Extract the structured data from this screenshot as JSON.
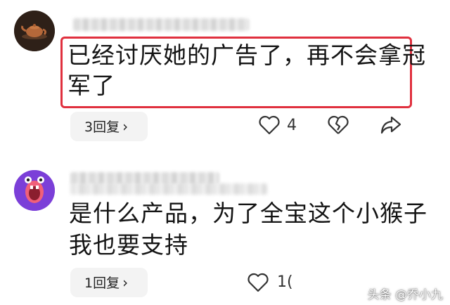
{
  "comments": [
    {
      "text_line1": "已经讨厌她的广告了，再不会拿冠",
      "text_line2": "军了",
      "reply_label": "3回复",
      "like_count": "4",
      "highlighted": true,
      "highlight_color": "#e0303e"
    },
    {
      "text_line1": "是什么产品，为了全宝这个小猴子",
      "text_line2": "我也要支持",
      "reply_label": "1回复",
      "like_count": "1(",
      "highlighted": false
    }
  ],
  "watermark": "头条 @乔小九",
  "icons": {
    "like": "heart-icon",
    "dislike": "broken-heart-icon",
    "share": "share-arrow-icon",
    "chevron": "chevron-right-icon"
  },
  "colors": {
    "highlight": "#e0303e",
    "pill_bg": "#f3f3f3",
    "text": "#141414"
  }
}
